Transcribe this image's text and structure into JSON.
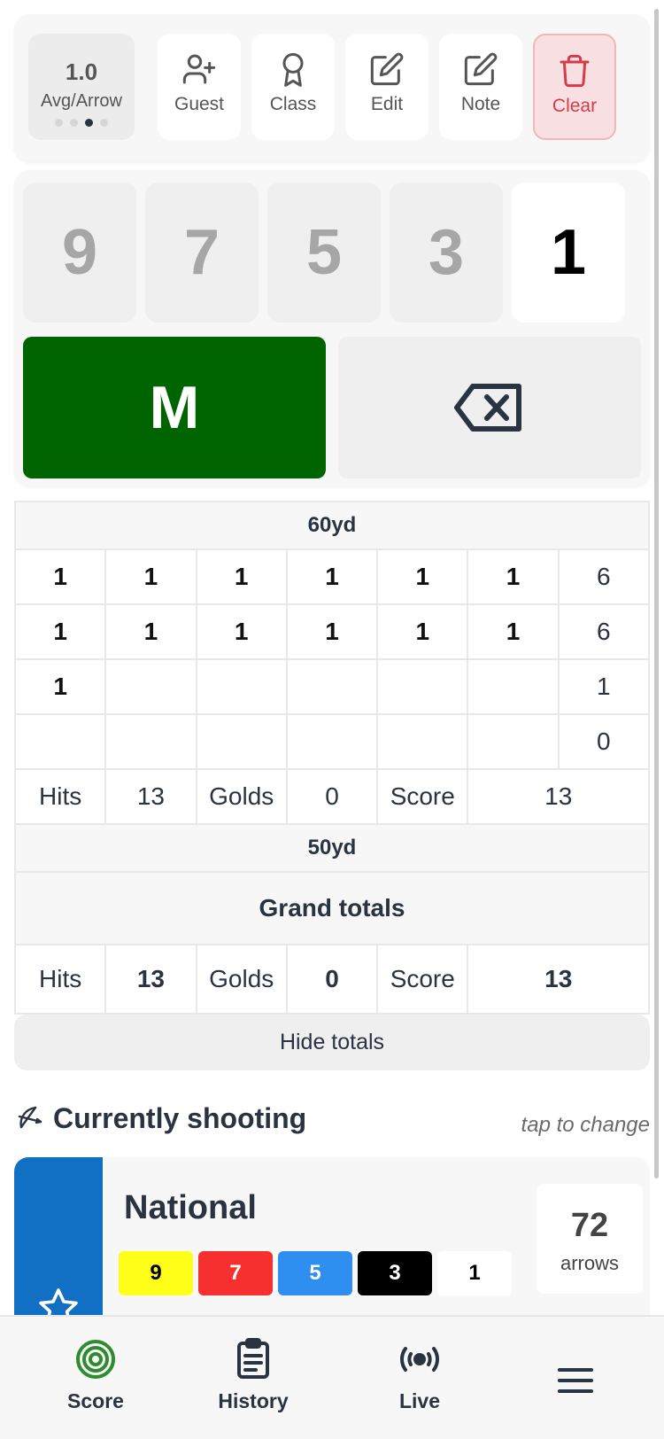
{
  "toolbar": {
    "avg_value": "1.0",
    "avg_label": "Avg/Arrow",
    "buttons": {
      "guest": "Guest",
      "class": "Class",
      "edit": "Edit",
      "note": "Note",
      "clear": "Clear"
    }
  },
  "keypad": {
    "keys": [
      "9",
      "7",
      "5",
      "3",
      "1"
    ],
    "miss": "M",
    "backspace_icon": "backspace-icon"
  },
  "scores": {
    "distance_60": "60yd",
    "rows": [
      [
        "1",
        "1",
        "1",
        "1",
        "1",
        "1",
        "6"
      ],
      [
        "1",
        "1",
        "1",
        "1",
        "1",
        "1",
        "6"
      ],
      [
        "1",
        "",
        "",
        "",
        "",
        "",
        "1"
      ],
      [
        "",
        "",
        "",
        "",
        "",
        "",
        "0"
      ]
    ],
    "sub_totals": {
      "hits_label": "Hits",
      "hits": "13",
      "golds_label": "Golds",
      "golds": "0",
      "score_label": "Score",
      "score": "13"
    },
    "distance_50": "50yd",
    "grand_title": "Grand totals",
    "grand_totals": {
      "hits_label": "Hits",
      "hits": "13",
      "golds_label": "Golds",
      "golds": "0",
      "score_label": "Score",
      "score": "13"
    },
    "hide_totals": "Hide totals"
  },
  "current": {
    "title": "Currently shooting",
    "hint": "tap to change",
    "round_name": "National",
    "chips": [
      "9",
      "7",
      "5",
      "3",
      "1"
    ],
    "arrows_count": "72",
    "arrows_label": "arrows"
  },
  "nav": {
    "score": "Score",
    "history": "History",
    "live": "Live",
    "menu_icon": "hamburger-menu-icon"
  },
  "colors": {
    "miss_green": "#006400",
    "round_blue": "#1170c4",
    "chip_gold": "#ffff1a",
    "chip_red": "#f5302e",
    "chip_blue": "#2e8ff0",
    "chip_black": "#000000",
    "chip_white": "#ffffff",
    "clear_red": "#d63b49"
  }
}
